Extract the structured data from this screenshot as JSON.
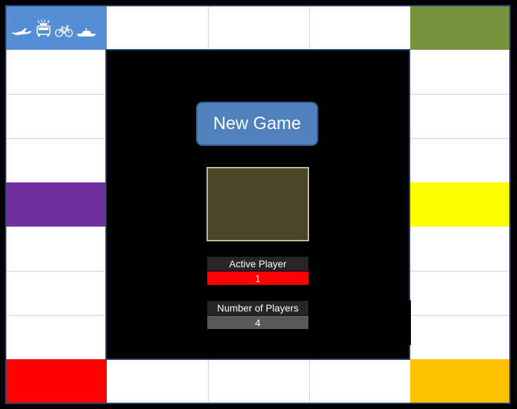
{
  "board": {
    "colors": {
      "border": "#1f3f6e",
      "start_cell": "#558ed5",
      "top_right": "#77933c",
      "left_middle": "#7030a0",
      "right_middle": "#ffff00",
      "bottom_left": "#ff0000",
      "bottom_right": "#ffc000"
    },
    "start_cell_icons": [
      "airplane-icon",
      "police-car-icon",
      "bicycle-icon",
      "boat-icon"
    ]
  },
  "controls": {
    "new_game_label": "New Game",
    "active_player_label": "Active Player",
    "active_player_value": "1",
    "active_player_color": "#ff0000",
    "num_players_label": "Number of Players",
    "num_players_value": "4",
    "num_players_color": "#595959"
  }
}
